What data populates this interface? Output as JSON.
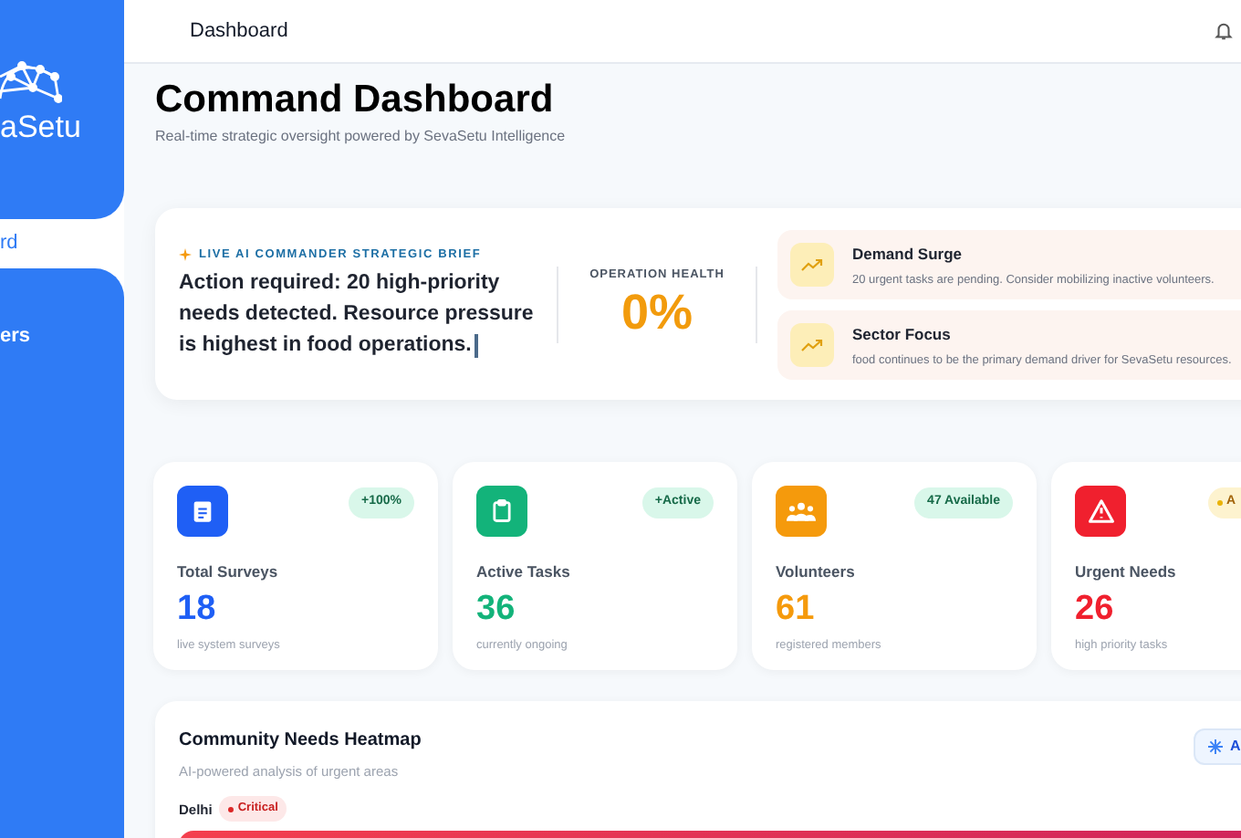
{
  "sidebar": {
    "brand": "aSetu",
    "items": [
      {
        "label": "rd",
        "selected": true
      },
      {
        "label": "ers",
        "selected": false
      }
    ]
  },
  "header": {
    "title": "Dashboard"
  },
  "page": {
    "title": "Command Dashboard",
    "subtitle": "Real-time strategic oversight powered by SevaSetu Intelligence"
  },
  "brief": {
    "label": "LIVE AI COMMANDER STRATEGIC BRIEF",
    "text": "Action required: 20 high-priority needs detected. Resource pressure is highest in food operations.",
    "health_label": "OPERATION HEALTH",
    "health_value": "0%",
    "alerts": [
      {
        "title": "Demand Surge",
        "text": "20 urgent tasks are pending. Consider mobilizing inactive volunteers."
      },
      {
        "title": "Sector Focus",
        "text": "food continues to be the primary demand driver for SevaSetu resources."
      }
    ]
  },
  "stats": [
    {
      "kind": "clipboard",
      "color": "#1f5ff5",
      "badge": {
        "text": "+100%",
        "kind": "success"
      },
      "label": "Total Surveys",
      "value": "18",
      "caption": "live system surveys"
    },
    {
      "kind": "task",
      "color": "#13b37a",
      "badge": {
        "text": "+Active",
        "kind": "success"
      },
      "label": "Active Tasks",
      "value": "36",
      "caption": "currently ongoing"
    },
    {
      "kind": "people",
      "color": "#f59a0c",
      "badge": {
        "text": "47 Available",
        "kind": "success"
      },
      "label": "Volunteers",
      "value": "61",
      "caption": "registered members"
    },
    {
      "kind": "alert",
      "color": "#f0202e",
      "badge": {
        "text": "A",
        "kind": "warning"
      },
      "label": "Urgent Needs",
      "value": "26",
      "caption": "high priority tasks"
    }
  ],
  "heatmap": {
    "title": "Community Needs Heatmap",
    "subtitle": "AI-powered analysis of urgent areas",
    "button": "A",
    "regions": [
      {
        "name": "Delhi",
        "tag": "Critical"
      }
    ]
  }
}
